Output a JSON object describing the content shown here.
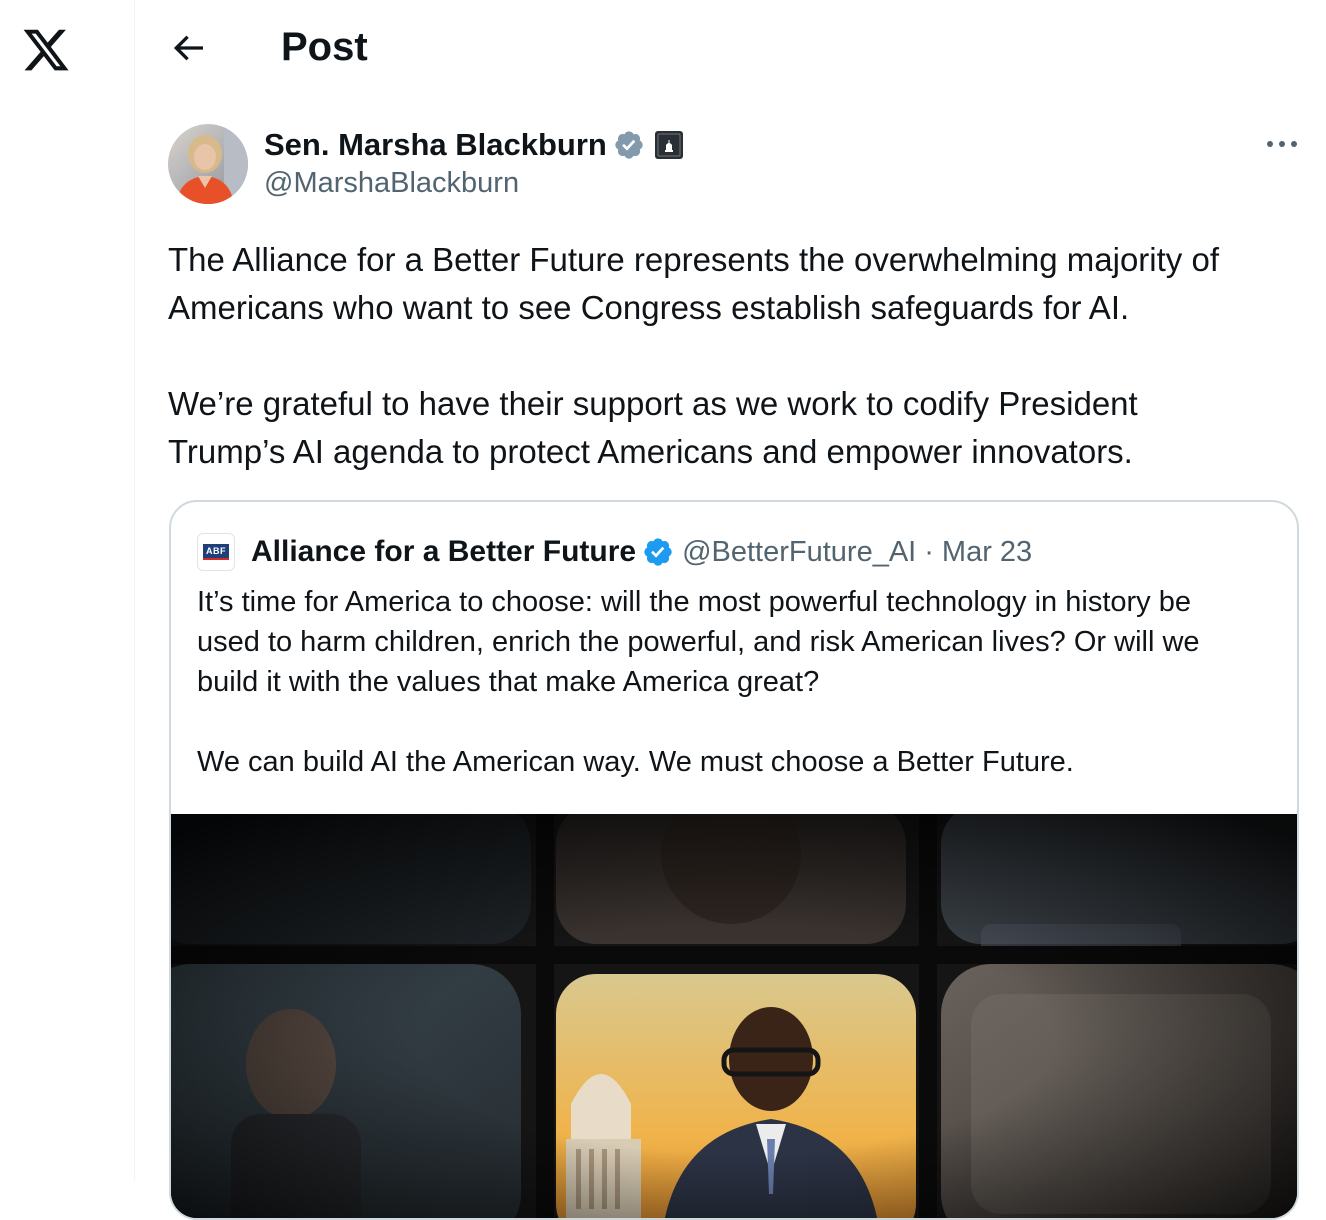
{
  "nav": {
    "logo_icon": "x-logo-icon"
  },
  "header": {
    "back_icon": "back-arrow-icon",
    "title": "Post"
  },
  "post": {
    "author": {
      "display_name": "Sen. Marsha Blackburn",
      "handle": "@MarshaBlackburn",
      "verified_icon": "verified-badge-icon",
      "affiliation_icon": "government-badge-icon"
    },
    "more_icon": "more-icon",
    "text": "The Alliance for a Better Future represents the overwhelming majority of\nAmericans who want to see Congress establish safeguards for AI.\n\nWe’re grateful to have their support as we work to codify President\nTrump’s AI agenda to protect Americans and empower innovators.",
    "quoted": {
      "avatar_text": "ABF",
      "display_name": "Alliance for a Better Future",
      "handle": "@BetterFuture_AI",
      "separator": "·",
      "date": "Mar 23",
      "text": "It’s time for America to choose: will the most powerful technology in history be\nused to harm children, enrich the powerful, and risk American lives? Or will we\nbuild it with the values that make America great?\n\nWe can build AI the American way. We must choose a Better Future."
    }
  },
  "colors": {
    "text": "#0f1419",
    "secondary": "#536471",
    "verified": "#1d9bf0",
    "gray_verified": "#829aab",
    "border": "#cfd9de"
  }
}
